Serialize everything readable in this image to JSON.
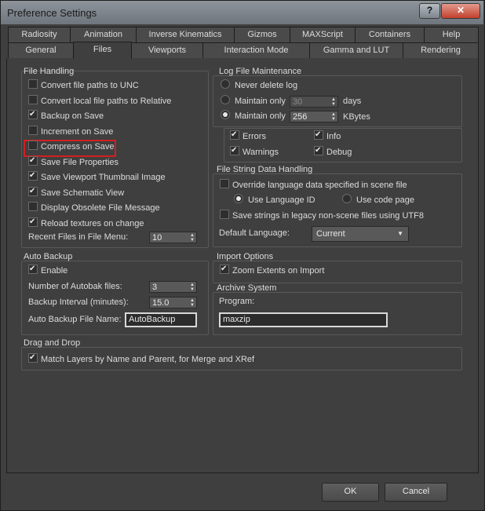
{
  "window": {
    "title": "Preference Settings",
    "help_label": "?",
    "close_label": "✕"
  },
  "tabs_row1": [
    "Radiosity",
    "Animation",
    "Inverse Kinematics",
    "Gizmos",
    "MAXScript",
    "Containers",
    "Help"
  ],
  "tabs_row2": [
    "General",
    "Files",
    "Viewports",
    "Interaction Mode",
    "Gamma and LUT",
    "Rendering"
  ],
  "file_handling": {
    "title": "File Handling",
    "options": [
      {
        "label": "Convert file paths to UNC",
        "checked": false
      },
      {
        "label": "Convert local file paths to Relative",
        "checked": false
      },
      {
        "label": "Backup on Save",
        "checked": true
      },
      {
        "label": "Increment on Save",
        "checked": false
      },
      {
        "label": "Compress on Save",
        "checked": false
      },
      {
        "label": "Save File Properties",
        "checked": true
      },
      {
        "label": "Save Viewport Thumbnail Image",
        "checked": true
      },
      {
        "label": "Save Schematic View",
        "checked": true
      },
      {
        "label": "Display Obsolete File Message",
        "checked": false
      },
      {
        "label": "Reload textures on change",
        "checked": true
      }
    ],
    "recent_label": "Recent Files in File Menu:",
    "recent_value": "10"
  },
  "log": {
    "title": "Log File Maintenance",
    "never_label": "Never delete log",
    "days_label": "Maintain only",
    "days_value": "30",
    "days_unit": "days",
    "kb_label": "Maintain only",
    "kb_value": "256",
    "kb_unit": "KBytes",
    "errors_label": "Errors",
    "info_label": "Info",
    "warnings_label": "Warnings",
    "debug_label": "Debug"
  },
  "string_data": {
    "title": "File String Data Handling",
    "override_label": "Override language data specified in scene file",
    "lang_id_label": "Use Language ID",
    "code_page_label": "Use code page",
    "utf8_label": "Save strings in legacy non-scene files using UTF8",
    "default_lang_label": "Default Language:",
    "default_lang_value": "Current"
  },
  "auto_backup": {
    "title": "Auto Backup",
    "enable_label": "Enable",
    "num_label": "Number of Autobak files:",
    "num_value": "3",
    "interval_label": "Backup Interval (minutes):",
    "interval_value": "15.0",
    "name_label": "Auto Backup File Name:",
    "name_value": "AutoBackup"
  },
  "import": {
    "title": "Import Options",
    "zoom_label": "Zoom Extents on Import"
  },
  "archive": {
    "title": "Archive System",
    "program_label": "Program:",
    "program_value": "maxzip"
  },
  "drag": {
    "title": "Drag and Drop",
    "match_label": "Match Layers by Name and Parent, for Merge and XRef"
  },
  "buttons": {
    "ok": "OK",
    "cancel": "Cancel"
  }
}
